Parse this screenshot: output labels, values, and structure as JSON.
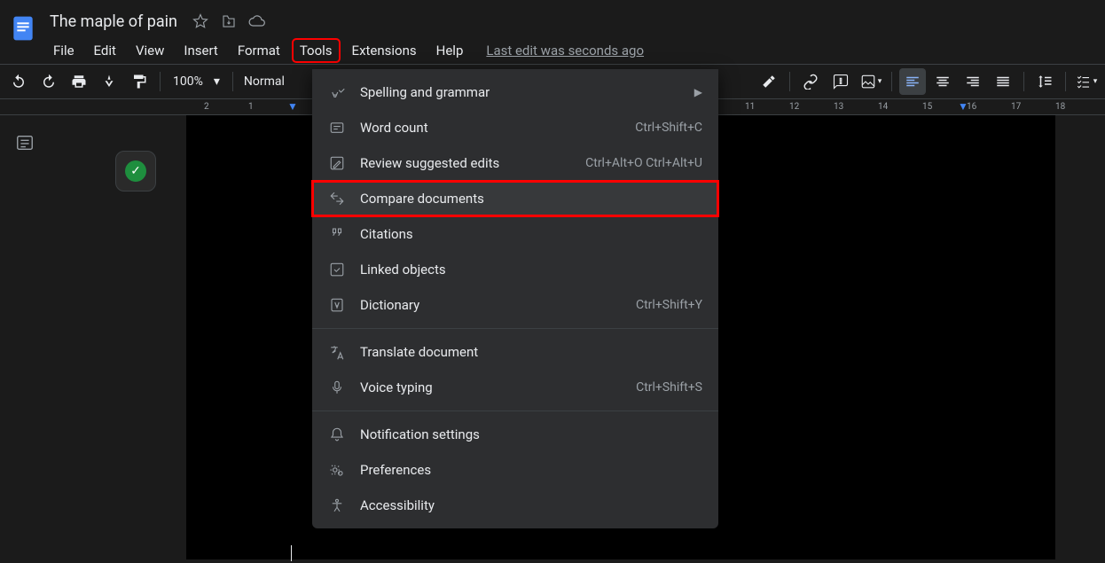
{
  "doc": {
    "title": "The maple of pain",
    "last_edit": "Last edit was seconds ago"
  },
  "menus": {
    "file": "File",
    "edit": "Edit",
    "view": "View",
    "insert": "Insert",
    "format": "Format",
    "tools": "Tools",
    "extensions": "Extensions",
    "help": "Help"
  },
  "toolbar": {
    "zoom": "100%",
    "style": "Normal"
  },
  "ruler": {
    "left": [
      "2",
      "1"
    ],
    "right": [
      "11",
      "12",
      "13",
      "14",
      "15",
      "16",
      "17",
      "18"
    ]
  },
  "tools_menu": {
    "spelling": {
      "label": "Spelling and grammar"
    },
    "wordcount": {
      "label": "Word count",
      "shortcut": "Ctrl+Shift+C"
    },
    "review": {
      "label": "Review suggested edits",
      "shortcut": "Ctrl+Alt+O Ctrl+Alt+U"
    },
    "compare": {
      "label": "Compare documents"
    },
    "citations": {
      "label": "Citations"
    },
    "linked": {
      "label": "Linked objects"
    },
    "dictionary": {
      "label": "Dictionary",
      "shortcut": "Ctrl+Shift+Y"
    },
    "translate": {
      "label": "Translate document"
    },
    "voice": {
      "label": "Voice typing",
      "shortcut": "Ctrl+Shift+S"
    },
    "notification": {
      "label": "Notification settings"
    },
    "preferences": {
      "label": "Preferences"
    },
    "accessibility": {
      "label": "Accessibility"
    }
  }
}
